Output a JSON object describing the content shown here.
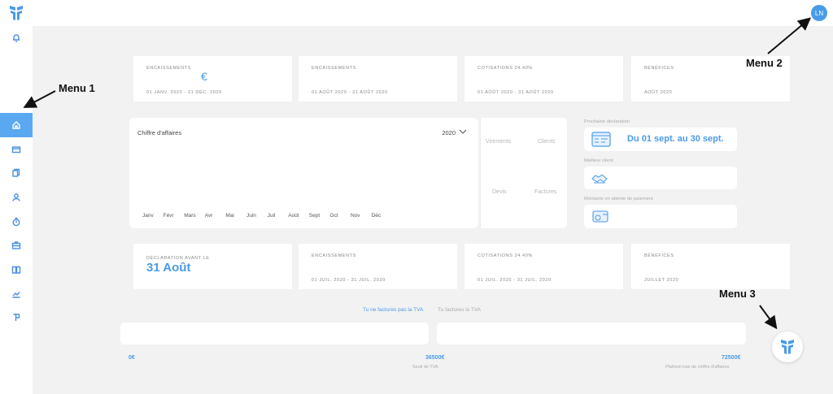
{
  "sidebar": {
    "icons": [
      "bell-icon",
      "home-icon",
      "card-icon",
      "documents-icon",
      "user-icon",
      "timer-icon",
      "briefcase-icon",
      "book-icon",
      "chart-icon",
      "flag-icon"
    ],
    "active": "home-icon"
  },
  "topbar": {
    "avatar_initials": "LN"
  },
  "stats_top": [
    {
      "label": "ENCAISSEMENTS",
      "sub": "01 JANV. 2020 - 31 DÉC. 2020",
      "symbol": "€"
    },
    {
      "label": "ENCAISSEMENTS",
      "sub": "01 AOÛT 2020 - 31 AOÛT 2020"
    },
    {
      "label": "COTISATIONS 24.40%",
      "sub": "01 AOÛT 2020 - 31 AOÛT 2020"
    },
    {
      "label": "BÉNÉFICES",
      "sub": "AOÛT 2020"
    }
  ],
  "chart": {
    "title": "Chiffre d'affaires",
    "year": "2020",
    "months": [
      "Janv",
      "Févr",
      "Mars",
      "Avr",
      "Mai",
      "Juin",
      "Juil",
      "Août",
      "Sept",
      "Oct",
      "Nov",
      "Déc"
    ]
  },
  "mini": {
    "virements": "Virements",
    "clients": "Clients",
    "devis": "Devis",
    "factures": "Factures"
  },
  "right_panel": {
    "declaration_label": "Prochaine déclaration",
    "declaration_text": "Du 01 sept. au 30 sept.",
    "best_client_label": "Meilleur client",
    "pending_label": "Montants en attente de paiement"
  },
  "stats_bottom": [
    {
      "label": "DÉCLARATION AVANT LE",
      "big": "31 Août"
    },
    {
      "label": "ENCAISSEMENTS",
      "sub": "01 JUIL. 2020 - 31 JUIL. 2020"
    },
    {
      "label": "COTISATIONS 24.40%",
      "sub": "01 JUIL. 2020 - 31 JUIL. 2020"
    },
    {
      "label": "BÉNÉFICES",
      "sub": "JUILLET 2020"
    }
  ],
  "tva": {
    "tab_active": "Tu ne factures pas la TVA",
    "tab_inactive": "Tu factures la TVA",
    "scale_min": "0€",
    "scale_mid": "36500€",
    "scale_mid_label": "Seuil de TVA",
    "scale_max": "72500€",
    "scale_max_label": "Plafond max de chiffre d'affaires"
  },
  "annotations": {
    "menu1": "Menu 1",
    "menu2": "Menu 2",
    "menu3": "Menu 3"
  },
  "colors": {
    "accent": "#4a9be8",
    "active_bg": "#5aa8f0",
    "background": "#f2f2f2"
  }
}
